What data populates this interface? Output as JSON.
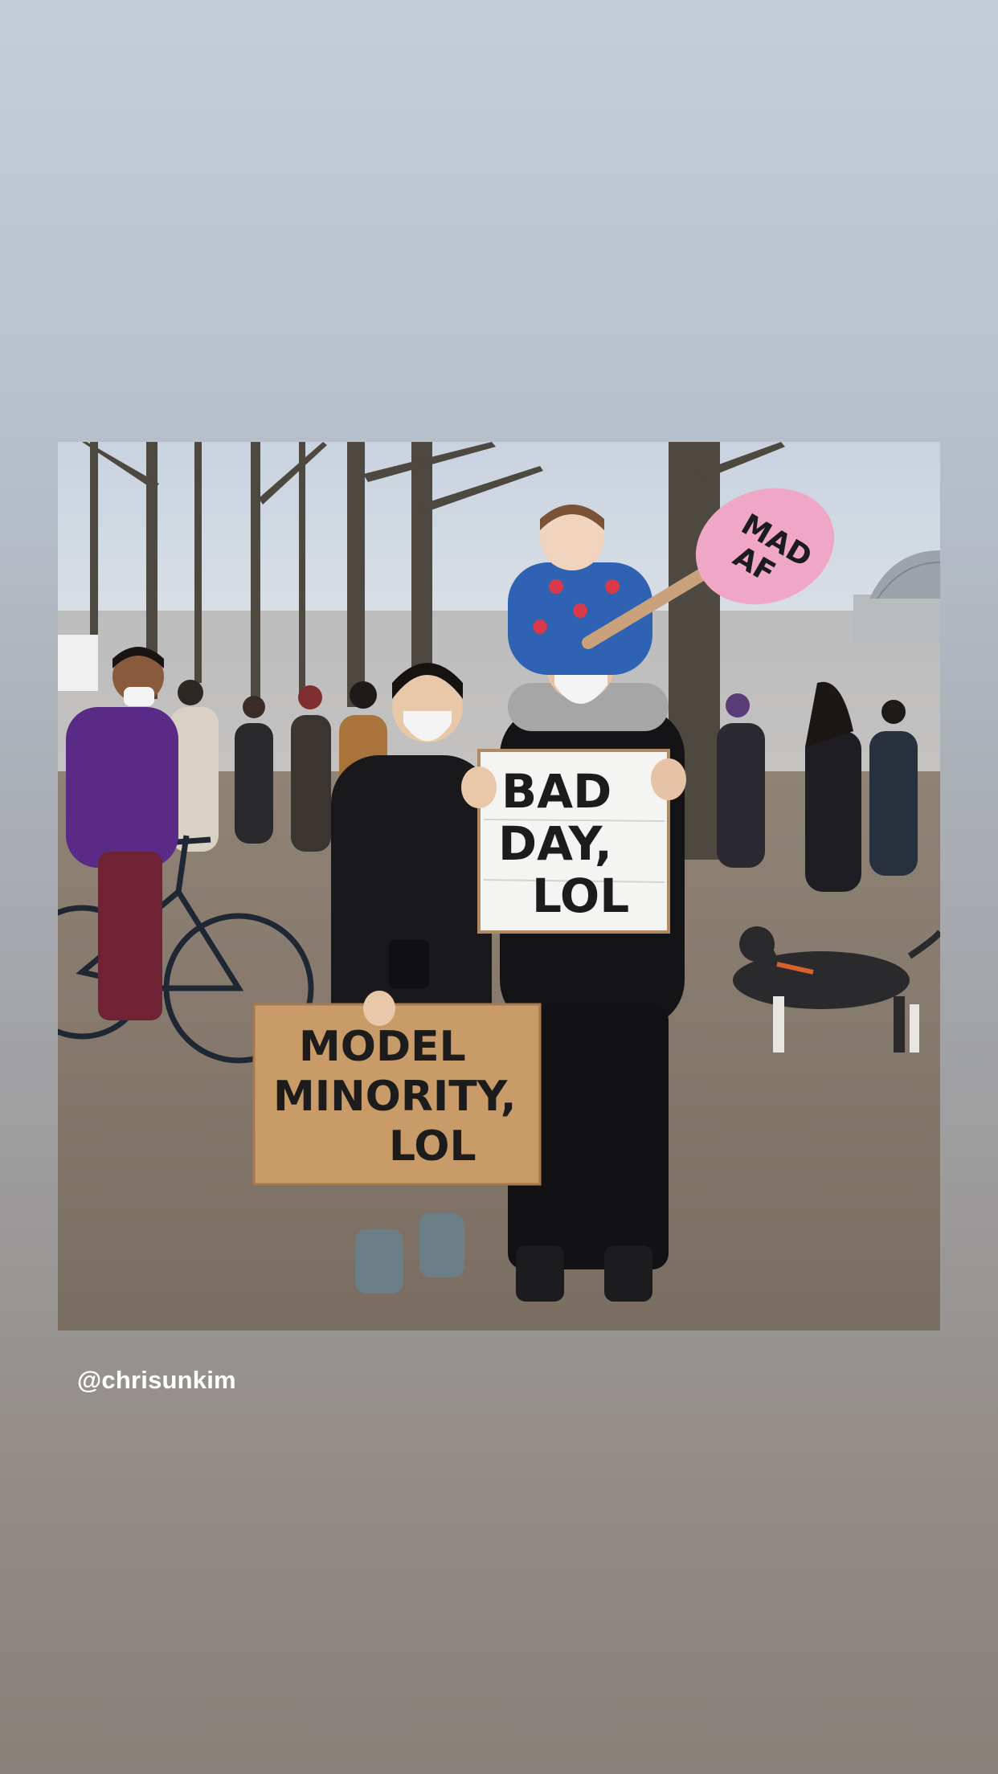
{
  "story": {
    "mention": "@chrisunkim",
    "background_top": "#c4ceda",
    "background_bottom": "#878079"
  },
  "photo": {
    "signs": {
      "center_sign": [
        "BAD",
        "DAY,",
        "LOL"
      ],
      "bottom_sign": [
        "MODEL",
        "MINORITY,",
        "LOL"
      ],
      "paddle_sign": [
        "MAD",
        "AF"
      ]
    },
    "colors": {
      "sky": "#d6dde6",
      "ground": "#8c7f72",
      "cardboard": "#c99b68",
      "paddle": "#f0a7c6",
      "hoodie": "#5a2a87"
    }
  }
}
